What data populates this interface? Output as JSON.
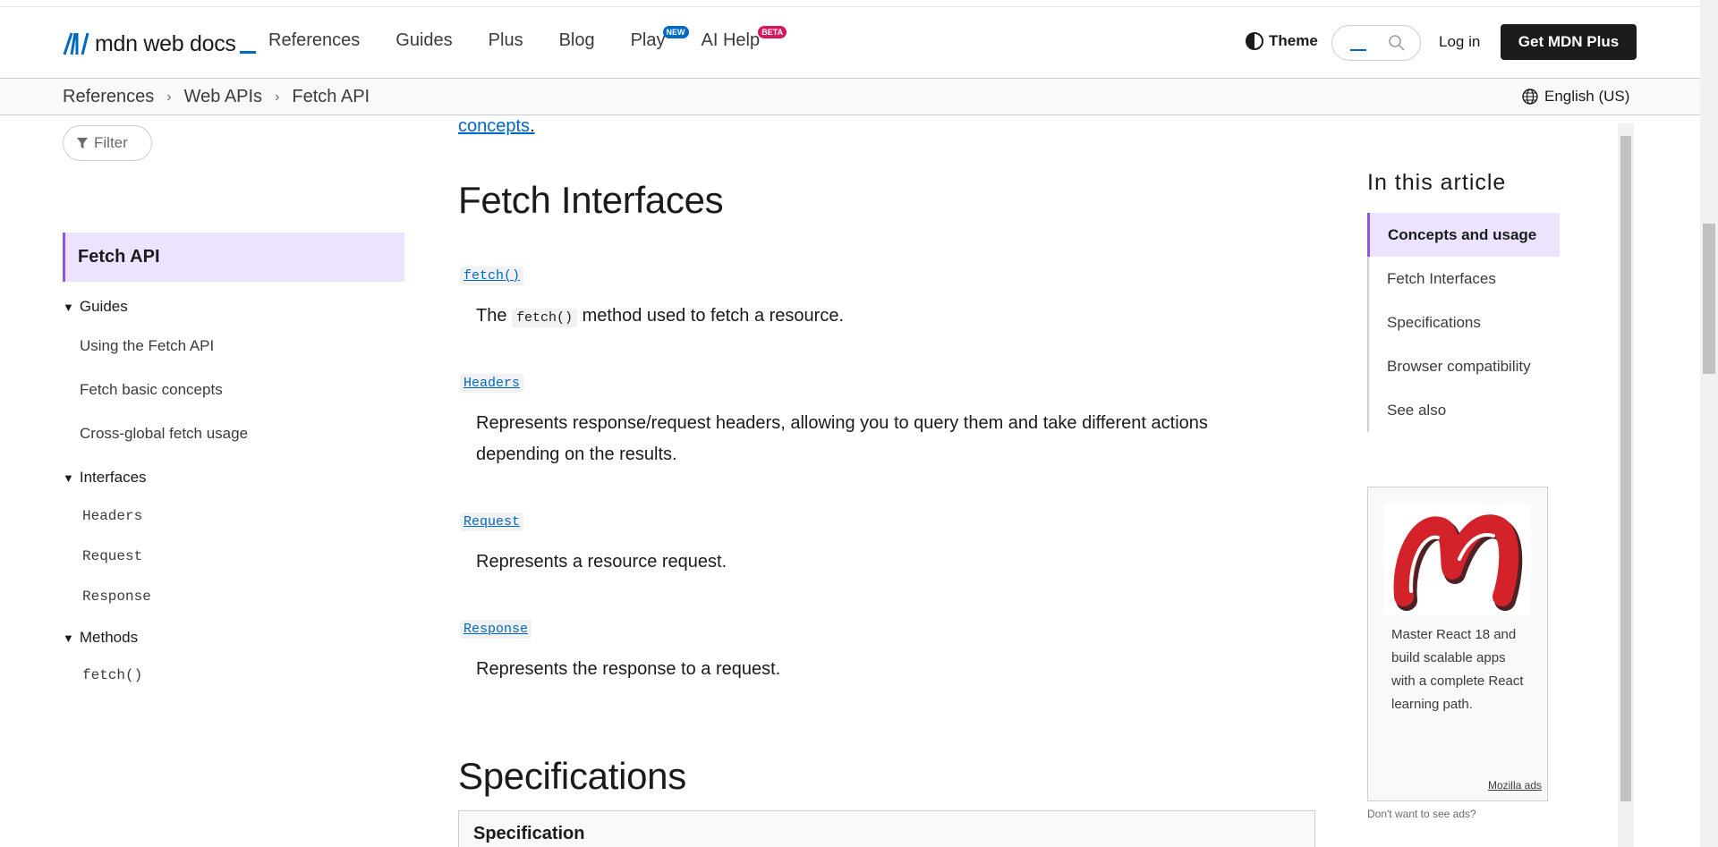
{
  "header": {
    "logo_text": "mdn web docs",
    "nav": [
      {
        "label": "References"
      },
      {
        "label": "Guides"
      },
      {
        "label": "Plus"
      },
      {
        "label": "Blog"
      },
      {
        "label": "Play",
        "badge": "NEW"
      },
      {
        "label": "AI Help",
        "badge": "BETA"
      }
    ],
    "theme_label": "Theme",
    "login_label": "Log in",
    "cta_label": "Get MDN Plus"
  },
  "breadcrumb": [
    "References",
    "Web APIs",
    "Fetch API"
  ],
  "language": "English (US)",
  "sidebar": {
    "filter_placeholder": "Filter",
    "active": "Fetch API",
    "groups": [
      {
        "label": "Guides",
        "items": [
          "Using the Fetch API",
          "Fetch basic concepts",
          "Cross-global fetch usage"
        ]
      },
      {
        "label": "Interfaces",
        "items": [
          "Headers",
          "Request",
          "Response"
        ]
      },
      {
        "label": "Methods",
        "items": [
          "fetch()"
        ]
      }
    ]
  },
  "main": {
    "concepts_link": "concepts",
    "concepts_tail": ".",
    "interfaces_heading": "Fetch Interfaces",
    "entries": [
      {
        "term": "fetch()",
        "desc_before": "The ",
        "desc_code": "fetch()",
        "desc_after": " method used to fetch a resource."
      },
      {
        "term": "Headers",
        "desc": "Represents response/request headers, allowing you to query them and take different actions depending on the results."
      },
      {
        "term": "Request",
        "desc": "Represents a resource request."
      },
      {
        "term": "Response",
        "desc": "Represents the response to a request."
      }
    ],
    "specifications_heading": "Specifications",
    "spec_table_header": "Specification"
  },
  "toc": {
    "title": "In this article",
    "items": [
      "Concepts and usage",
      "Fetch Interfaces",
      "Specifications",
      "Browser compatibility",
      "See also"
    ],
    "active_index": 0
  },
  "ad": {
    "text": "Master React 18 and build scalable apps with a complete React learning path.",
    "link": "Mozilla ads",
    "note": "Don't want to see ads?"
  },
  "colors": {
    "accent": "#0069c2",
    "active_bg": "#ebe3ff",
    "active_border": "#8e57e2",
    "ad_brand_red": "#d4222b"
  }
}
